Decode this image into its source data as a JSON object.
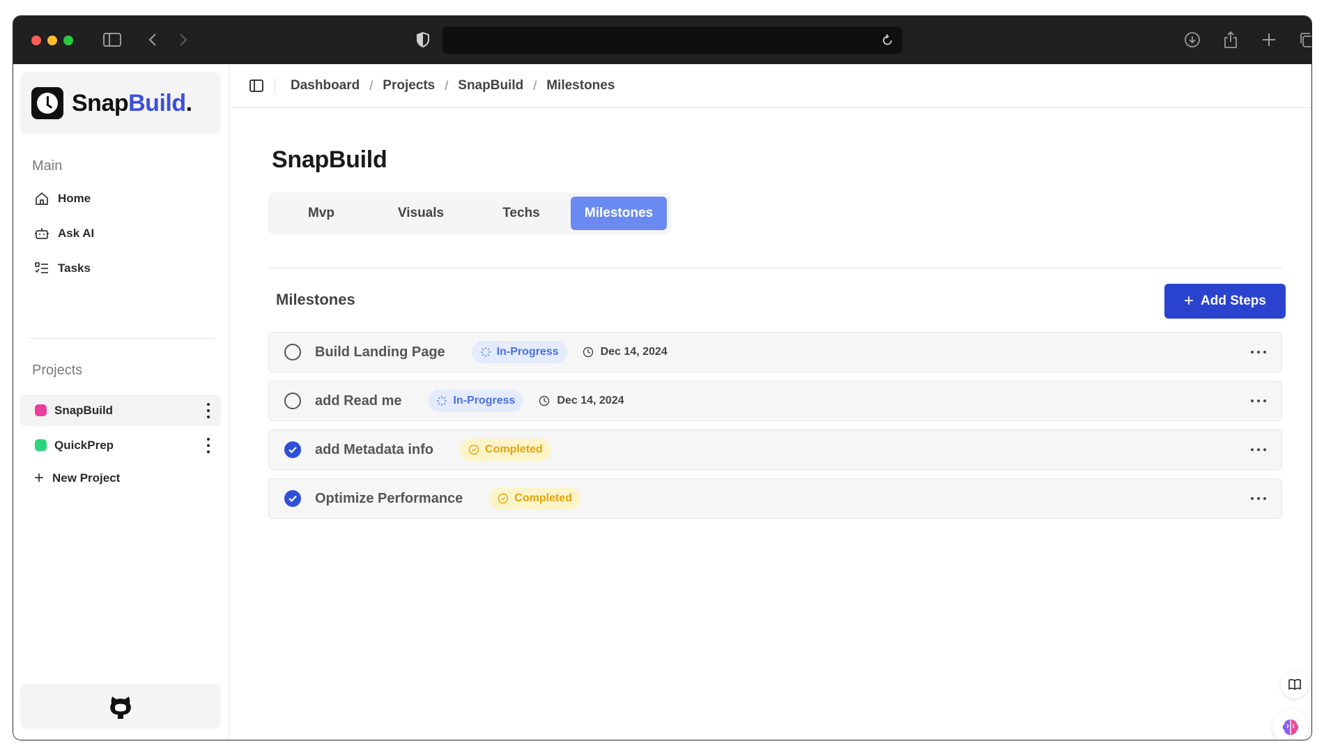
{
  "app": {
    "brand_name": "Snap",
    "brand_accent": "Build",
    "brand_dot": ".",
    "accent_color": "#3b4fe0"
  },
  "sidebar": {
    "main_label": "Main",
    "nav": [
      {
        "label": "Home",
        "icon": "home-icon"
      },
      {
        "label": "Ask AI",
        "icon": "bot-icon"
      },
      {
        "label": "Tasks",
        "icon": "list-checks-icon"
      }
    ],
    "projects_label": "Projects",
    "projects": [
      {
        "label": "SnapBuild",
        "color": "#e83e9c",
        "active": true
      },
      {
        "label": "QuickPrep",
        "color": "#2bd47d",
        "active": false
      }
    ],
    "new_project_label": "New Project"
  },
  "breadcrumb": [
    "Dashboard",
    "Projects",
    "SnapBuild",
    "Milestones"
  ],
  "page": {
    "title": "SnapBuild",
    "tabs": [
      {
        "label": "Mvp",
        "active": false
      },
      {
        "label": "Visuals",
        "active": false
      },
      {
        "label": "Techs",
        "active": false
      },
      {
        "label": "Milestones",
        "active": true
      }
    ],
    "section_title": "Milestones",
    "add_button_label": "Add Steps"
  },
  "milestones": [
    {
      "name": "Build Landing Page",
      "status": "In-Progress",
      "done": false,
      "date": "Dec 14, 2024"
    },
    {
      "name": "add Read me",
      "status": "In-Progress",
      "done": false,
      "date": "Dec 14, 2024"
    },
    {
      "name": "add Metadata info",
      "status": "Completed",
      "done": true,
      "date": ""
    },
    {
      "name": "Optimize Performance",
      "status": "Completed",
      "done": true,
      "date": ""
    }
  ]
}
